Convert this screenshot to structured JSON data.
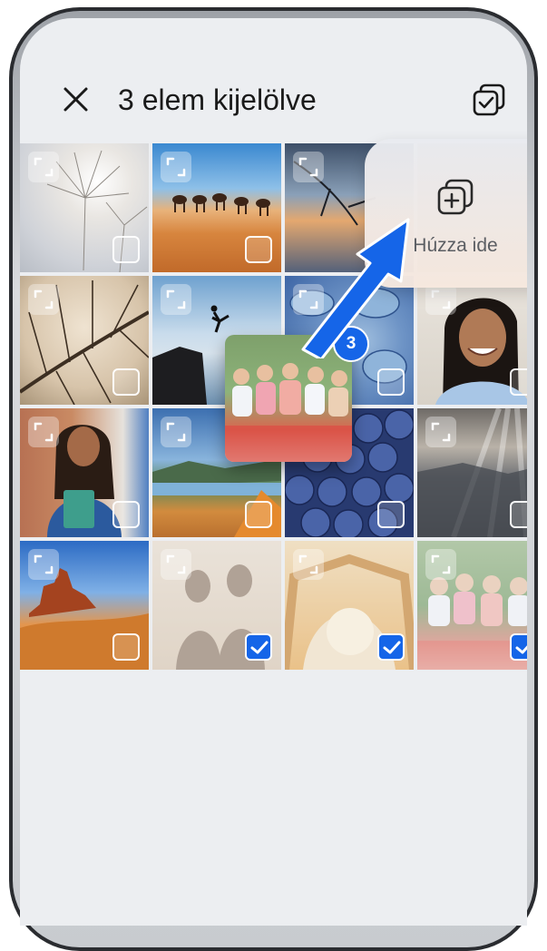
{
  "header": {
    "title": "3 elem kijelölve",
    "close_icon": "close-icon",
    "select_all_icon": "checkbox-multiple-icon"
  },
  "drop_zone": {
    "label": "Húzza ide",
    "icon": "add-to-album-icon"
  },
  "drag_preview": {
    "count": "3"
  },
  "grid": {
    "items": [
      {
        "name": "dandelion-photo",
        "selected": false
      },
      {
        "name": "desert-camels-photo",
        "selected": false
      },
      {
        "name": "sunset-branch-photo",
        "selected": false
      },
      {
        "name": "hidden-photo-4",
        "selected": false
      },
      {
        "name": "leaf-veins-photo",
        "selected": false
      },
      {
        "name": "cliff-jump-photo",
        "selected": false
      },
      {
        "name": "succulent-photo",
        "selected": false
      },
      {
        "name": "smiling-woman-photo",
        "selected": false
      },
      {
        "name": "student-with-books-photo",
        "selected": false
      },
      {
        "name": "lake-tent-photo",
        "selected": false
      },
      {
        "name": "blueberries-photo",
        "selected": false
      },
      {
        "name": "sun-rays-landscape-photo",
        "selected": false
      },
      {
        "name": "red-rocks-desert-photo",
        "selected": false
      },
      {
        "name": "couple-shadow-photo",
        "selected": true
      },
      {
        "name": "tent-view-photo",
        "selected": true
      },
      {
        "name": "picnic-friends-photo",
        "selected": true
      }
    ]
  }
}
